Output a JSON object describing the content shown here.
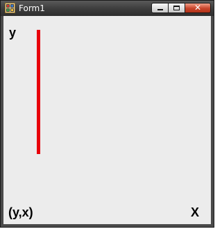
{
  "window": {
    "title": "Form1"
  },
  "canvas": {
    "labels": {
      "y": "y",
      "origin": "(y,x)",
      "x": "X"
    },
    "line_color": "#e8000b"
  }
}
